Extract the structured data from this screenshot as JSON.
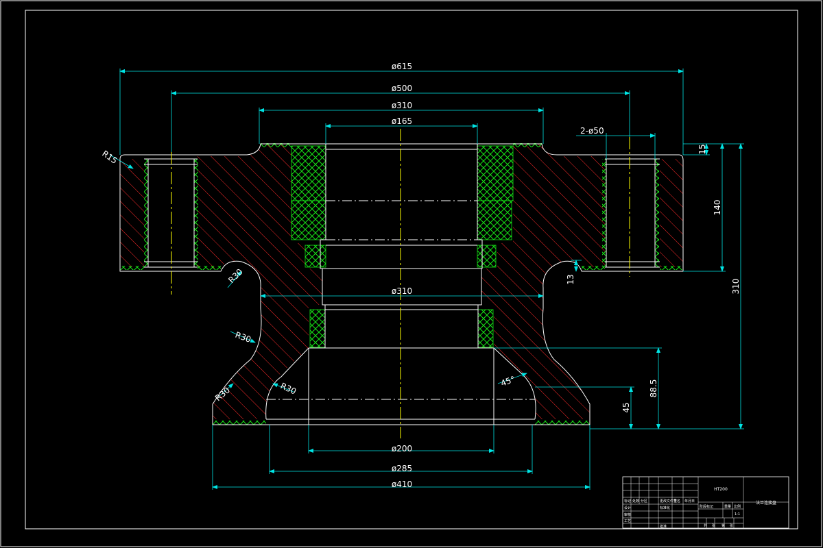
{
  "colors": {
    "background": "#000000",
    "outline": "#ffffff",
    "hatch": "#ff2a2a",
    "crosshatch": "#16e316",
    "dimension": "#00e5e5",
    "centerline": "#ffff00"
  },
  "dimensions": {
    "d615": "ø615",
    "d500": "ø500",
    "d310_top": "ø310",
    "d165": "ø165",
    "holes": "2-ø50",
    "r15": "R15",
    "r30_a": "R30",
    "r30_b": "R30",
    "r30_c": "R30",
    "r30_d": "R30",
    "d310_mid": "ø310",
    "angle45": "45°",
    "d200": "ø200",
    "d285": "ø285",
    "d410": "ø410",
    "h15": "15",
    "h140": "140",
    "h13": "13",
    "h310": "310",
    "h88_5": "88.5",
    "h45": "45"
  },
  "title_block": {
    "material": "HT200",
    "part_name": "法兰连接盘",
    "row_labels": [
      "标记",
      "设计",
      "审核",
      "工艺"
    ],
    "col_labels": [
      "处数",
      "分区",
      "更改文件号",
      "签名",
      "年月日"
    ],
    "stage_label": "阶段标记",
    "weight_label": "重量",
    "scale_label": "比例",
    "scale_value": "1:1",
    "standard_label": "标准化",
    "approve_label": "批准",
    "sheet_labels": [
      "共",
      "张",
      "第",
      "张"
    ]
  }
}
